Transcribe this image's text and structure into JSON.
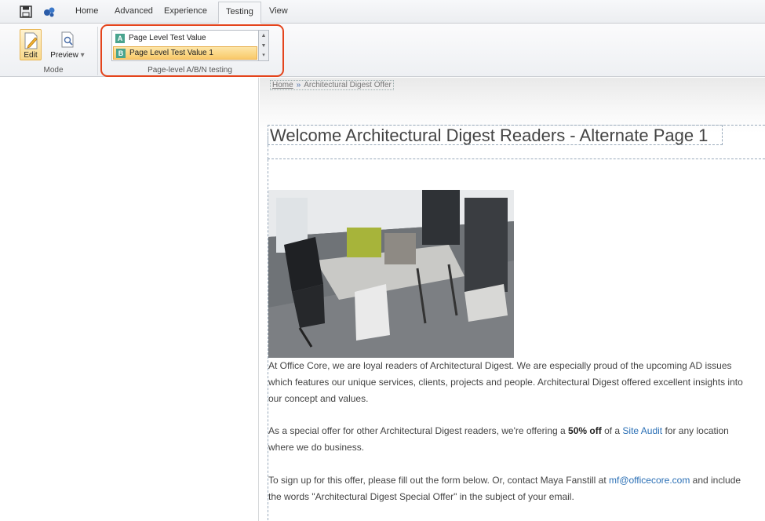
{
  "ribbon": {
    "tabs": [
      {
        "label": "Home"
      },
      {
        "label": "Advanced"
      },
      {
        "label": "Experience"
      },
      {
        "label": "Testing"
      },
      {
        "label": "View"
      }
    ],
    "active_tab": "Testing",
    "mode_group": {
      "edit_label": "Edit",
      "preview_label": "Preview",
      "group_label": "Mode"
    },
    "testing_group": {
      "group_label": "Page-level A/B/N testing",
      "variants": [
        {
          "badge": "A",
          "label": "Page Level Test Value",
          "badge_color": "#4aa48e"
        },
        {
          "badge": "B",
          "label": "Page Level Test Value 1",
          "badge_color": "#4aa48e"
        }
      ],
      "selected_index": 1
    }
  },
  "page": {
    "breadcrumb": {
      "home": "Home",
      "separator": "»",
      "current": "Architectural Digest Offer"
    },
    "title": "Welcome Architectural Digest Readers - Alternate Page 1",
    "para1": "At Office Core, we are loyal readers of Architectural Digest. We are especially proud of the upcoming AD issues which features our unique services, clients, projects and people.  Architectural Digest offered excellent insights into our concept and values.",
    "para2": {
      "before": "As a special offer for other Architectural Digest readers, we're offering a ",
      "bold": "50% off",
      "middle": " of a ",
      "link": "Site Audit",
      "after": " for any location where we do business."
    },
    "para3": {
      "before": "To sign up for this offer, please fill out the form below. Or, contact Maya Fanstill at  ",
      "link": "mf@officecore.com",
      "after": " and include the words \"Architectural Digest Special Offer\" in the subject of your email."
    }
  },
  "colors": {
    "accent_highlight": "#e4441c",
    "link": "#2a6fb5",
    "selected_item": "#f9c96a"
  },
  "icons": [
    "save-icon",
    "sitecore-logo-icon",
    "edit-icon",
    "preview-icon"
  ]
}
